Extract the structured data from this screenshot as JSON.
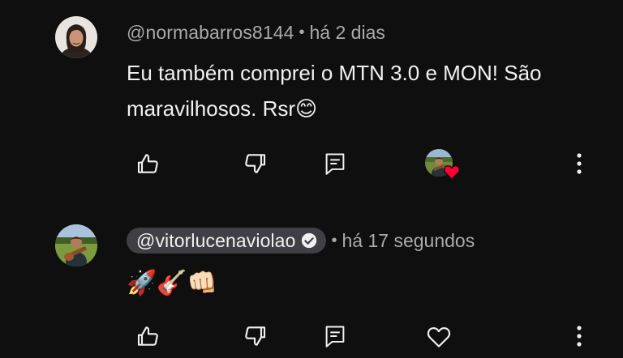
{
  "comments": [
    {
      "username": "@normabarros8144",
      "separator": "•",
      "timestamp": "há 2 dias",
      "text": "Eu também comprei o MTN 3.0 e MON! São maravilhosos. Rsr😊",
      "actions": [
        "thumbs-up-icon",
        "thumbs-down-icon",
        "reply-icon",
        "creator-heart-badge",
        "more-options-icon"
      ]
    },
    {
      "username": "@vitorlucenaviolao",
      "verified": true,
      "separator": "•",
      "timestamp": "há 17 segundos",
      "text": "🚀🎸👊🏻",
      "actions": [
        "thumbs-up-icon",
        "thumbs-down-icon",
        "reply-icon",
        "heart-icon",
        "more-options-icon"
      ]
    }
  ],
  "colors": {
    "background": "#0f0f0f",
    "primary_text": "#f1f1f1",
    "secondary_text": "#aaaaaa",
    "creator_pill": "#3f3f45",
    "heart_red": "#ff0033"
  }
}
